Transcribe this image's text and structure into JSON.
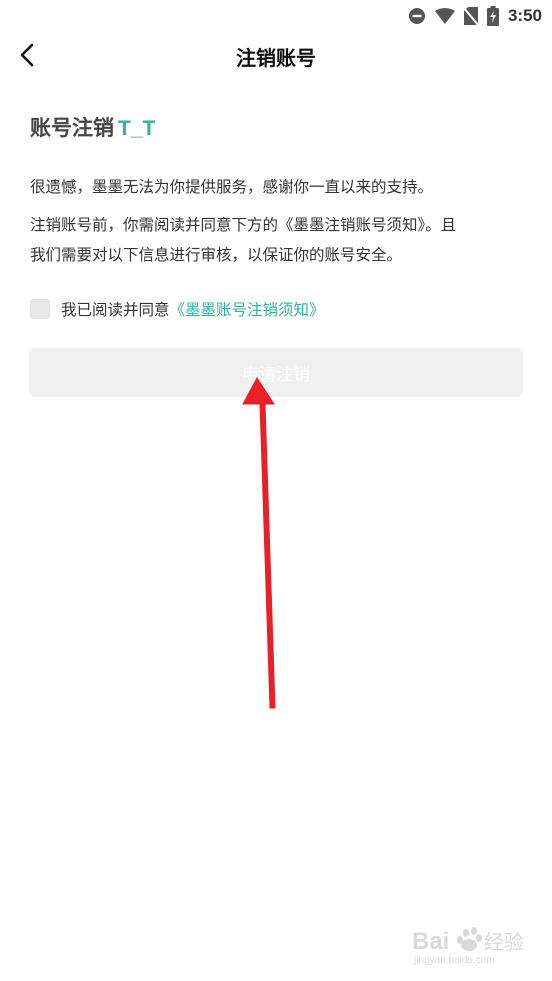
{
  "status_bar": {
    "time": "3:50",
    "icons": [
      "do-not-disturb-icon",
      "wifi-icon",
      "no-sim-icon",
      "battery-icon"
    ]
  },
  "nav": {
    "title": "注销账号",
    "back_icon": "chevron-left-icon"
  },
  "content": {
    "heading": "账号注销",
    "heading_emoticon": "T_T",
    "paragraph1": "很遗憾，墨墨无法为你提供服务，感谢你一直以来的支持。",
    "paragraph2_line1": "注销账号前，你需阅读并同意下方的《墨墨注销账号须知》。且",
    "paragraph2_line2": "我们需要对以下信息进行审核，以保证你的账号安全。",
    "agree_text": "我已阅读并同意",
    "agree_link": "《墨墨账号注销须知》",
    "checkbox_checked": false,
    "apply_button_label": "申请注销",
    "apply_button_enabled": false
  },
  "watermark": {
    "brand": "Bai 经验",
    "url": "jingyan.baidu.com"
  },
  "colors": {
    "accent": "#2bb5a0",
    "button_disabled_bg": "#f0f0f0",
    "annotation_arrow": "#e8202a"
  }
}
